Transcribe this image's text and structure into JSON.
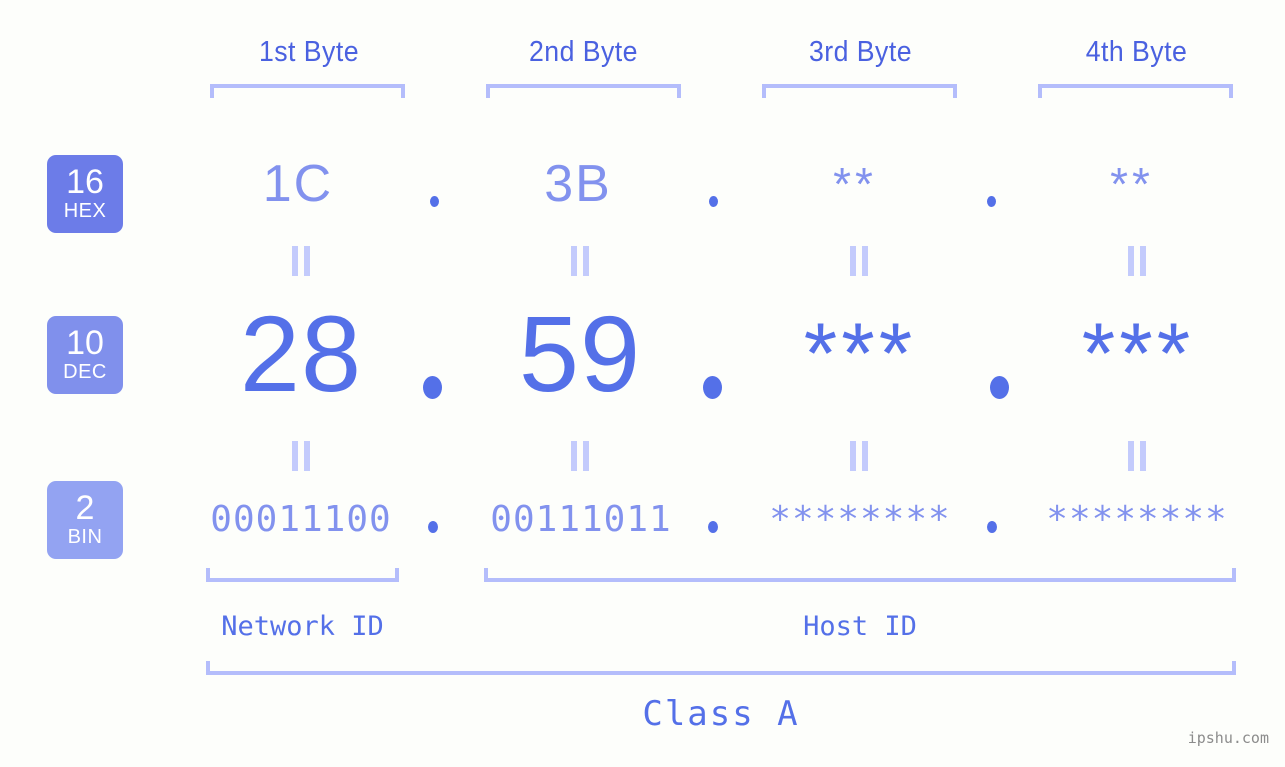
{
  "meta": {
    "background_color": "#fdfefb",
    "accent_dark": "#5470e8",
    "accent_mid": "#8292ee",
    "accent_light": "#b4bdfb",
    "badge_hex_color": "#6c7ce8",
    "badge_dec_color": "#8090ec",
    "badge_bin_color": "#93a3f2",
    "watermark": "ipshu.com"
  },
  "byte_headers": [
    {
      "label": "1st Byte"
    },
    {
      "label": "2nd Byte"
    },
    {
      "label": "3rd Byte"
    },
    {
      "label": "4th Byte"
    }
  ],
  "rows": [
    {
      "badge": {
        "number": "16",
        "label": "HEX"
      },
      "values": [
        "1C",
        "3B",
        "**",
        "**"
      ],
      "separators": [
        ".",
        ".",
        "."
      ]
    },
    {
      "badge": {
        "number": "10",
        "label": "DEC"
      },
      "values": [
        "28",
        "59",
        "***",
        "***"
      ],
      "separators": [
        ".",
        ".",
        "."
      ]
    },
    {
      "badge": {
        "number": "2",
        "label": "BIN"
      },
      "values": [
        "00011100",
        "00111011",
        "********",
        "********"
      ],
      "separators": [
        ".",
        ".",
        "."
      ]
    }
  ],
  "equality_marks": {
    "symbol": "=",
    "count_per_row": 4
  },
  "id_sections": [
    {
      "label": "Network ID"
    },
    {
      "label": "Host ID"
    }
  ],
  "class_section": {
    "label": "Class A"
  }
}
